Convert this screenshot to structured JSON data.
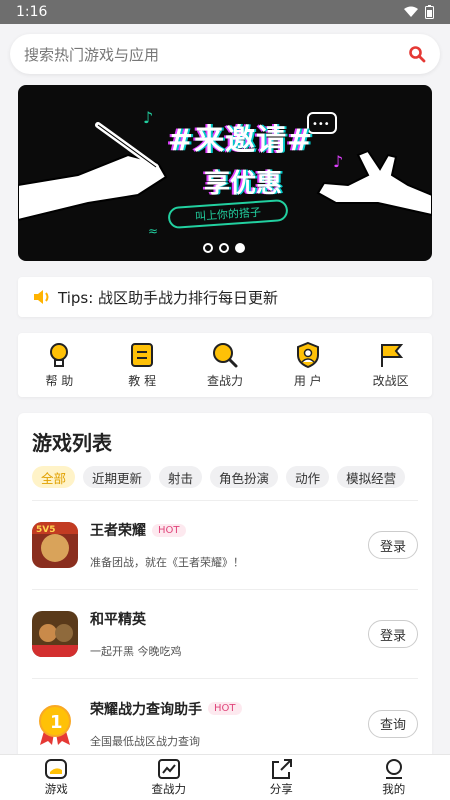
{
  "status": {
    "time": "1:16"
  },
  "search": {
    "placeholder": "搜索热门游戏与应用"
  },
  "banner": {
    "line1": "#来邀请#",
    "line2": "享优惠",
    "tag": "叫上你的搭子"
  },
  "tips": {
    "text": "Tips: 战区助手战力排行每日更新"
  },
  "quick": [
    {
      "label": "帮 助",
      "icon": "lightbulb-icon"
    },
    {
      "label": "教 程",
      "icon": "document-icon"
    },
    {
      "label": "查战力",
      "icon": "magnifier-icon"
    },
    {
      "label": "用 户",
      "icon": "user-shield-icon"
    },
    {
      "label": "改战区",
      "icon": "flag-icon"
    }
  ],
  "games": {
    "title": "游戏列表",
    "chips": [
      "全部",
      "近期更新",
      "射击",
      "角色扮演",
      "动作",
      "模拟经营"
    ],
    "items": [
      {
        "name": "王者荣耀",
        "hot": "HOT",
        "desc": "准备团战，就在《王者荣耀》！",
        "button": "登录"
      },
      {
        "name": "和平精英",
        "hot": "",
        "desc": "一起开黑 今晚吃鸡",
        "button": "登录"
      },
      {
        "name": "荣耀战力查询助手",
        "hot": "HOT",
        "desc": "全国最低战区战力查询",
        "button": "查询"
      }
    ]
  },
  "tabbar": [
    {
      "label": "游戏",
      "icon": "game-icon"
    },
    {
      "label": "查战力",
      "icon": "chart-icon"
    },
    {
      "label": "分享",
      "icon": "share-icon"
    },
    {
      "label": "我的",
      "icon": "profile-icon"
    }
  ],
  "colors": {
    "accent": "#ffc107",
    "search_icon": "#e53935",
    "hot": "#e0457b"
  }
}
